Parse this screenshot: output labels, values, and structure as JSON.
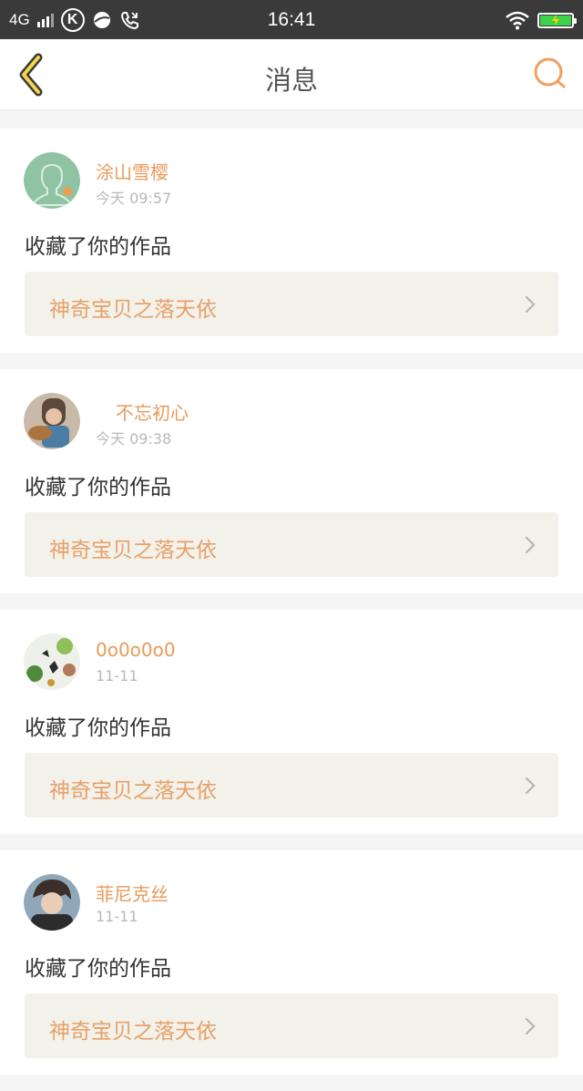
{
  "status_bar": {
    "network": "4G",
    "time": "16:41",
    "icons": [
      "signal-icon",
      "k-app-icon",
      "bubble-icon",
      "phone-icon",
      "wifi-icon",
      "battery-icon"
    ]
  },
  "header": {
    "title": "消息",
    "back_icon": "chevron-left-icon",
    "search_icon": "search-icon",
    "accent_color": "#f0a060"
  },
  "notifications": [
    {
      "user": "涂山雪樱",
      "time": "今天 09:57",
      "action": "收藏了你的作品",
      "work": "神奇宝贝之落天依"
    },
    {
      "user": "不忘初心",
      "time": "今天 09:38",
      "action": "收藏了你的作品",
      "work": "神奇宝贝之落天依"
    },
    {
      "user": "0o0o0o0",
      "time": "11-11",
      "action": "收藏了你的作品",
      "work": "神奇宝贝之落天依"
    },
    {
      "user": "菲尼克丝",
      "time": "11-11",
      "action": "收藏了你的作品",
      "work": "神奇宝贝之落天依"
    }
  ]
}
